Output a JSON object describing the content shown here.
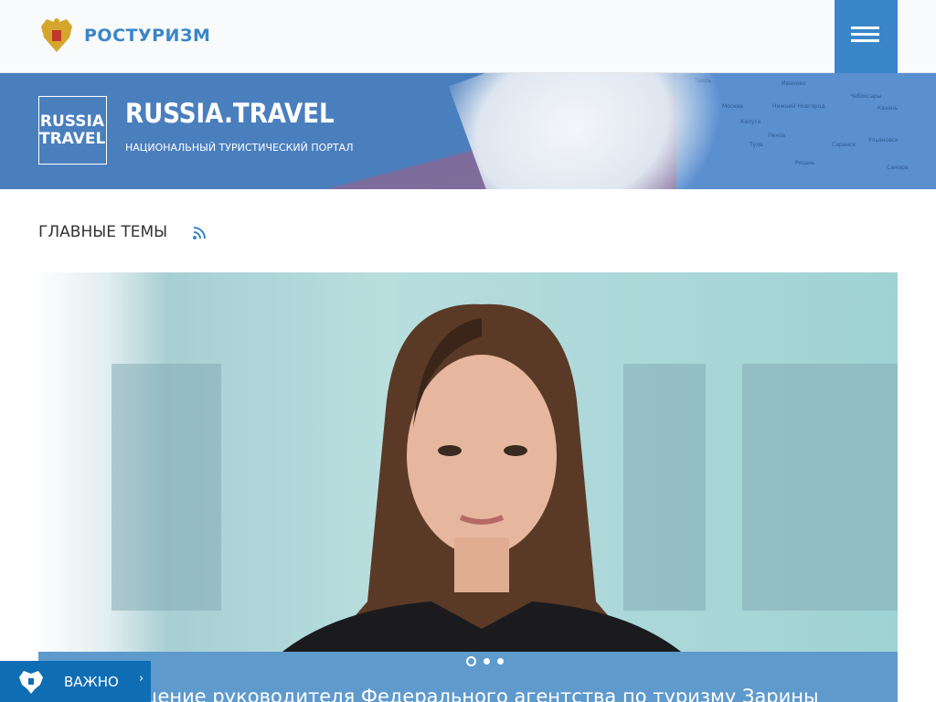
{
  "header": {
    "brand": "РОСТУРИЗМ",
    "menu_icon": "hamburger-icon",
    "accent": "#3a86c8"
  },
  "banner": {
    "logo_line1": "RUSSIA",
    "logo_line2": "TRAVEL",
    "title": "RUSSIA.TRAVEL",
    "subtitle": "НАЦИОНАЛЬНЫЙ ТУРИСТИЧЕСКИЙ ПОРТАЛ",
    "map_labels": [
      "Тверь",
      "Москва",
      "Нижний Новгород",
      "Калуга",
      "Тула",
      "Пенза",
      "Саранск",
      "Казань",
      "Ульяновск",
      "Самара",
      "Рязань",
      "Иваново",
      "Чебоксары"
    ]
  },
  "main": {
    "section_title": "ГЛАВНЫЕ ТЕМЫ",
    "rss_icon": "rss-icon",
    "slider": {
      "caption": "Обращение руководителя Федерального агентства по туризму Зарины",
      "slides": 3,
      "active": 1
    }
  },
  "important_button": {
    "label": "ВАЖНО",
    "chevron": "›"
  }
}
